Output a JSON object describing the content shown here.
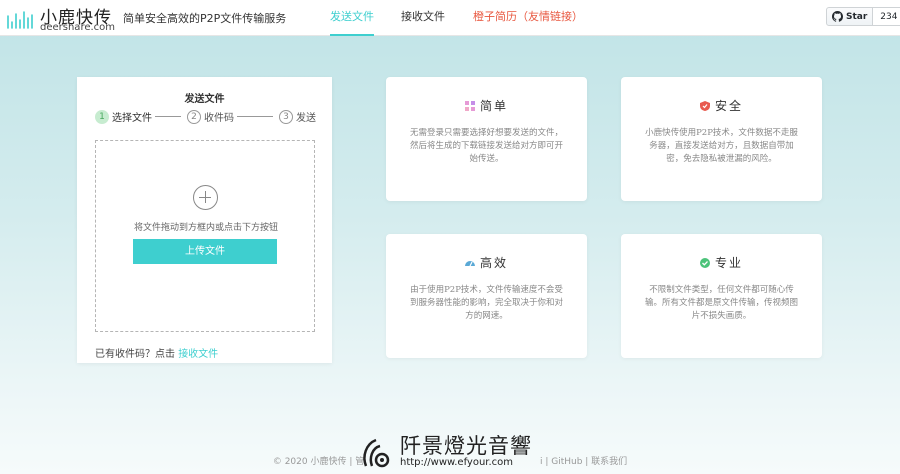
{
  "header": {
    "logo_name": "小鹿快传",
    "logo_domain": "deershare.com",
    "slogan": "简单安全高效的P2P文件传输服务",
    "nav": {
      "send": "发送文件",
      "receive": "接收文件",
      "resume": "橙子简历（友情链接）"
    },
    "github": {
      "star_label": "Star",
      "count": "234"
    }
  },
  "send_panel": {
    "title": "发送文件",
    "steps": [
      {
        "num": "1",
        "label": "选择文件"
      },
      {
        "num": "2",
        "label": "收件码"
      },
      {
        "num": "3",
        "label": "发送"
      }
    ],
    "drop_hint": "将文件拖动到方框内或点击下方按钮",
    "upload_button": "上传文件",
    "recv_prompt": "已有收件码？点击",
    "recv_link": "接收文件"
  },
  "features": [
    {
      "icon": "grid-icon",
      "title": "简单",
      "desc": "无需登录只需要选择好想要发送的文件，然后将生成的下载链接发送给对方即可开始传送。"
    },
    {
      "icon": "shield-icon",
      "title": "安全",
      "desc": "小鹿快传使用P2P技术，文件数据不走服务器，直接发送给对方，且数据自带加密，免去隐私被泄漏的风险。"
    },
    {
      "icon": "speed-icon",
      "title": "高效",
      "desc": "由于使用P2P技术，文件传输速度不会受到服务器性能的影响，完全取决于你和对方的网速。"
    },
    {
      "icon": "check-icon",
      "title": "专业",
      "desc": "不限制文件类型，任何文件都可随心传输。所有文件都是原文件传输，传视频图片不损失画质。"
    }
  ],
  "footer": {
    "text": "© 2020 小鹿快传 | 管",
    "text_tail": "i | GitHub | 联系我们"
  },
  "watermark": {
    "title": "阡景燈光音響",
    "url": "http://www.efyour.com"
  },
  "colors": {
    "accent": "#3ecfcf",
    "resume_link": "#e8573f",
    "step_active": "#c7ecd0"
  }
}
